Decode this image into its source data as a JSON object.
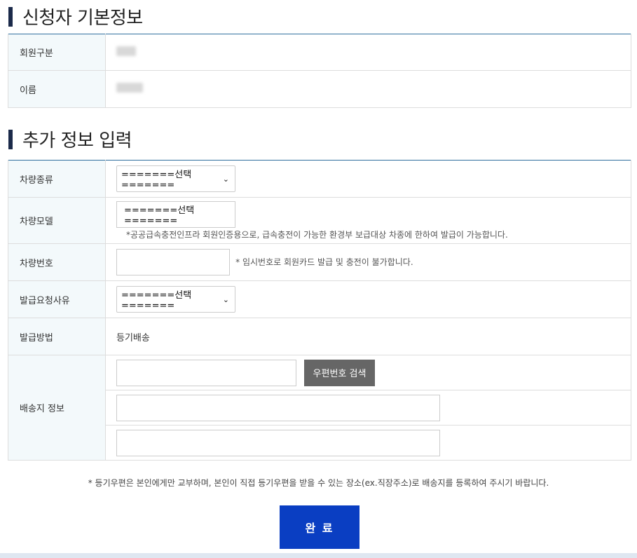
{
  "basic_section": {
    "title": "신청자 기본정보",
    "rows": [
      {
        "label": "회원구분"
      },
      {
        "label": "이름"
      }
    ]
  },
  "extra_section": {
    "title": "추가 정보 입력",
    "vehicle_type": {
      "label": "차량종류",
      "selected": "=======선택======="
    },
    "vehicle_model": {
      "label": "차량모델",
      "selected": "=======선택=======",
      "note": "*공공급속충전인프라 회원인증용으로, 급속충전이 가능한 환경부 보급대상 차종에 한하여 발급이 가능합니다."
    },
    "vehicle_number": {
      "label": "차량번호",
      "value": "",
      "note": "* 임시번호로 회원카드 발급 및 충전이 불가합니다."
    },
    "request_reason": {
      "label": "발급요청사유",
      "selected": "=======선택======="
    },
    "issue_method": {
      "label": "발급방법",
      "value": "등기배송"
    },
    "shipping": {
      "label": "배송지 정보",
      "zip_value": "",
      "zip_button": "우편번호 검색",
      "address1_value": "",
      "address2_value": ""
    }
  },
  "footer": {
    "note": "* 등기우편은 본인에게만 교부하며, 본인이 직접 등기우편을 받을 수 있는 장소(ex.직장주소)로 배송지를 등록하여 주시기 바랍니다.",
    "submit": "완 료"
  },
  "colors": {
    "title_bar": "#1b2a4a",
    "table_top_border": "#2e6e9e",
    "label_bg": "#f3f9fb",
    "submit_bg": "#0a3ec2",
    "zip_button_bg": "#666666"
  },
  "icons": {
    "select_arrow": "chevron-down-icon"
  }
}
